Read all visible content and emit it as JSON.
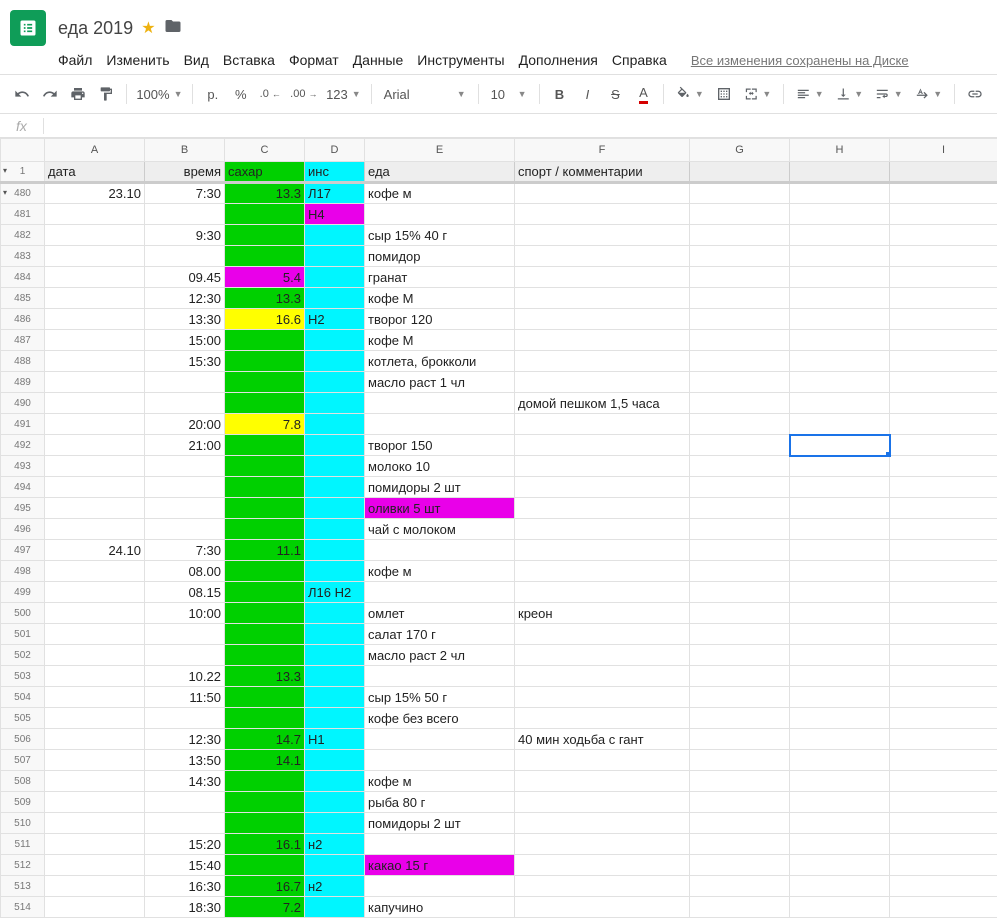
{
  "doc": {
    "title": "еда 2019",
    "save_status": "Все изменения сохранены на Диске"
  },
  "menu": [
    "Файл",
    "Изменить",
    "Вид",
    "Вставка",
    "Формат",
    "Данные",
    "Инструменты",
    "Дополнения",
    "Справка"
  ],
  "toolbar": {
    "zoom": "100%",
    "currency": "р.",
    "percent": "%",
    "dec_dec": ".0",
    "dec_inc": ".00",
    "more_fmt": "123",
    "font": "Arial",
    "size": "10"
  },
  "col_letters": [
    "",
    "A",
    "B",
    "C",
    "D",
    "E",
    "F",
    "G",
    "H",
    "I"
  ],
  "headers": {
    "a": "дата",
    "b": "время",
    "c": "сахар",
    "d": "инс",
    "e": "еда",
    "f": "спорт / комментарии"
  },
  "header_row_num": "1",
  "rows": [
    {
      "n": "480",
      "a": "23.10",
      "b": "7:30",
      "c": "13.3",
      "cc": "green",
      "d": "Л17",
      "e": "кофе м"
    },
    {
      "n": "481",
      "c": "",
      "cc": "green",
      "d": "Н4",
      "dc": "magenta-l"
    },
    {
      "n": "482",
      "b": "9:30",
      "c": "",
      "cc": "green",
      "e": "сыр 15% 40 г"
    },
    {
      "n": "483",
      "c": "",
      "cc": "green",
      "e": "помидор"
    },
    {
      "n": "484",
      "b": "09.45",
      "c": "5.4",
      "cc": "magenta",
      "e": "гранат"
    },
    {
      "n": "485",
      "b": "12:30",
      "c": "13.3",
      "cc": "green",
      "e": "кофе М"
    },
    {
      "n": "486",
      "b": "13:30",
      "c": "16.6",
      "cc": "yellow",
      "d": "Н2",
      "e": "творог 120"
    },
    {
      "n": "487",
      "b": "15:00",
      "c": "",
      "cc": "green",
      "e": "кофе М"
    },
    {
      "n": "488",
      "b": "15:30",
      "c": "",
      "cc": "green",
      "e": "котлета, брокколи"
    },
    {
      "n": "489",
      "c": "",
      "cc": "green",
      "e": "масло раст 1 чл"
    },
    {
      "n": "490",
      "c": "",
      "cc": "green",
      "f": "домой пешком 1,5 часа"
    },
    {
      "n": "491",
      "b": "20:00",
      "c": "7.8",
      "cc": "yellow"
    },
    {
      "n": "492",
      "b": "21:00",
      "c": "",
      "cc": "green",
      "e": "творог 150",
      "sel": "h"
    },
    {
      "n": "493",
      "c": "",
      "cc": "green",
      "e": "молоко 10"
    },
    {
      "n": "494",
      "c": "",
      "cc": "green",
      "e": "помидоры 2 шт"
    },
    {
      "n": "495",
      "c": "",
      "cc": "green",
      "e": "оливки 5 шт",
      "ec": "magenta-l"
    },
    {
      "n": "496",
      "c": "",
      "cc": "green",
      "e": "чай с молоком"
    },
    {
      "n": "497",
      "a": "24.10",
      "b": "7:30",
      "c": "11.1",
      "cc": "green"
    },
    {
      "n": "498",
      "b": "08.00",
      "c": "",
      "cc": "green",
      "e": "кофе м"
    },
    {
      "n": "499",
      "b": "08.15",
      "c": "",
      "cc": "green",
      "d": "Л16 Н2"
    },
    {
      "n": "500",
      "b": "10:00",
      "c": "",
      "cc": "green",
      "e": "омлет",
      "f": "креон"
    },
    {
      "n": "501",
      "c": "",
      "cc": "green",
      "e": "салат 170 г"
    },
    {
      "n": "502",
      "c": "",
      "cc": "green",
      "e": "масло раст 2 чл"
    },
    {
      "n": "503",
      "b": "10.22",
      "c": "13.3",
      "cc": "green"
    },
    {
      "n": "504",
      "b": "11:50",
      "c": "",
      "cc": "green",
      "e": "сыр 15% 50 г"
    },
    {
      "n": "505",
      "c": "",
      "cc": "green",
      "e": "кофе без всего"
    },
    {
      "n": "506",
      "b": "12:30",
      "c": "14.7",
      "cc": "green",
      "d": "Н1",
      "f": "40 мин ходьба с гант"
    },
    {
      "n": "507",
      "b": "13:50",
      "c": "14.1",
      "cc": "green"
    },
    {
      "n": "508",
      "b": "14:30",
      "c": "",
      "cc": "green",
      "e": "кофе м"
    },
    {
      "n": "509",
      "c": "",
      "cc": "green",
      "e": "рыба 80 г"
    },
    {
      "n": "510",
      "c": "",
      "cc": "green",
      "e": "помидоры 2 шт"
    },
    {
      "n": "511",
      "b": "15:20",
      "c": "16.1",
      "cc": "green",
      "d": "н2"
    },
    {
      "n": "512",
      "b": "15:40",
      "c": "",
      "cc": "green",
      "e": "какао 15 г",
      "ec": "magenta-l"
    },
    {
      "n": "513",
      "b": "16:30",
      "c": "16.7",
      "cc": "green",
      "d": "н2"
    },
    {
      "n": "514",
      "b": "18:30",
      "c": "7.2",
      "cc": "green",
      "e": "капучино"
    }
  ],
  "col_widths": {
    "row": 44,
    "a": 100,
    "b": 80,
    "c": 80,
    "d": 60,
    "e": 150,
    "f": 175,
    "g": 100,
    "h": 100,
    "i": 100
  }
}
